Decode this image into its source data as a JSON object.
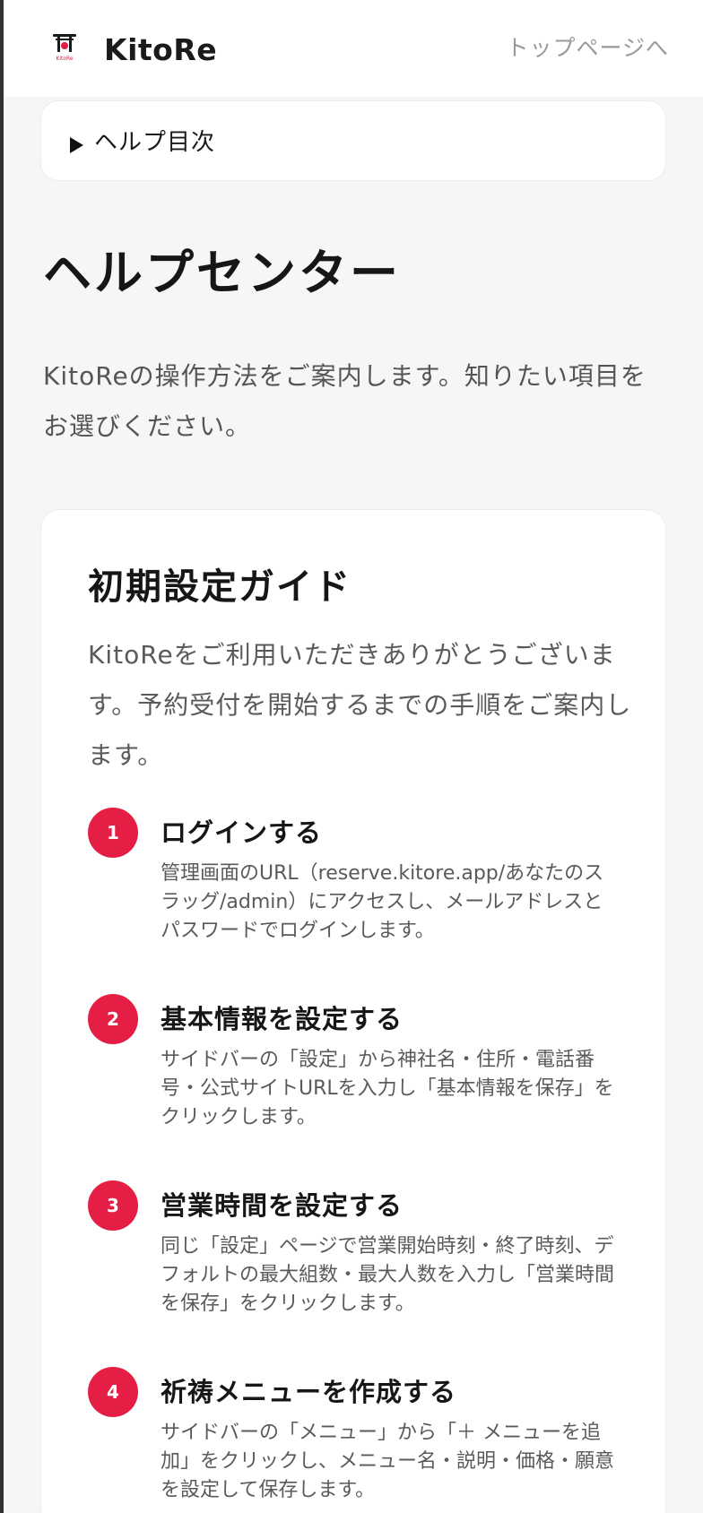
{
  "header": {
    "brand": "KitoRe",
    "logo_text": "KitoRe",
    "top_link": "トップページへ"
  },
  "toc": {
    "label": "ヘルプ目次"
  },
  "page": {
    "title": "ヘルプセンター",
    "intro": "KitoReの操作方法をご案内します。知りたい項目をお選びください。"
  },
  "guide": {
    "title": "初期設定ガイド",
    "description": "KitoReをご利用いただきありがとうございます。予約受付を開始するまでの手順をご案内します。",
    "steps": [
      {
        "number": "1",
        "title": "ログインする",
        "description": "管理画面のURL（reserve.kitore.app/あなたのスラッグ/admin）にアクセスし、メールアドレスとパスワードでログインします。"
      },
      {
        "number": "2",
        "title": "基本情報を設定する",
        "description": "サイドバーの「設定」から神社名・住所・電話番号・公式サイトURLを入力し「基本情報を保存」をクリックします。"
      },
      {
        "number": "3",
        "title": "営業時間を設定する",
        "description": "同じ「設定」ページで営業開始時刻・終了時刻、デフォルトの最大組数・最大人数を入力し「営業時間を保存」をクリックします。"
      },
      {
        "number": "4",
        "title": "祈祷メニューを作成する",
        "description": "サイドバーの「メニュー」から「＋ メニューを追加」をクリックし、メニュー名・説明・価格・願意を設定して保存します。"
      }
    ]
  },
  "colors": {
    "accent": "#e51e45",
    "background": "#f6f6f6",
    "card": "#ffffff"
  },
  "icons": {
    "logo": "torii-gate-icon",
    "toc_toggle": "triangle-right-icon"
  }
}
